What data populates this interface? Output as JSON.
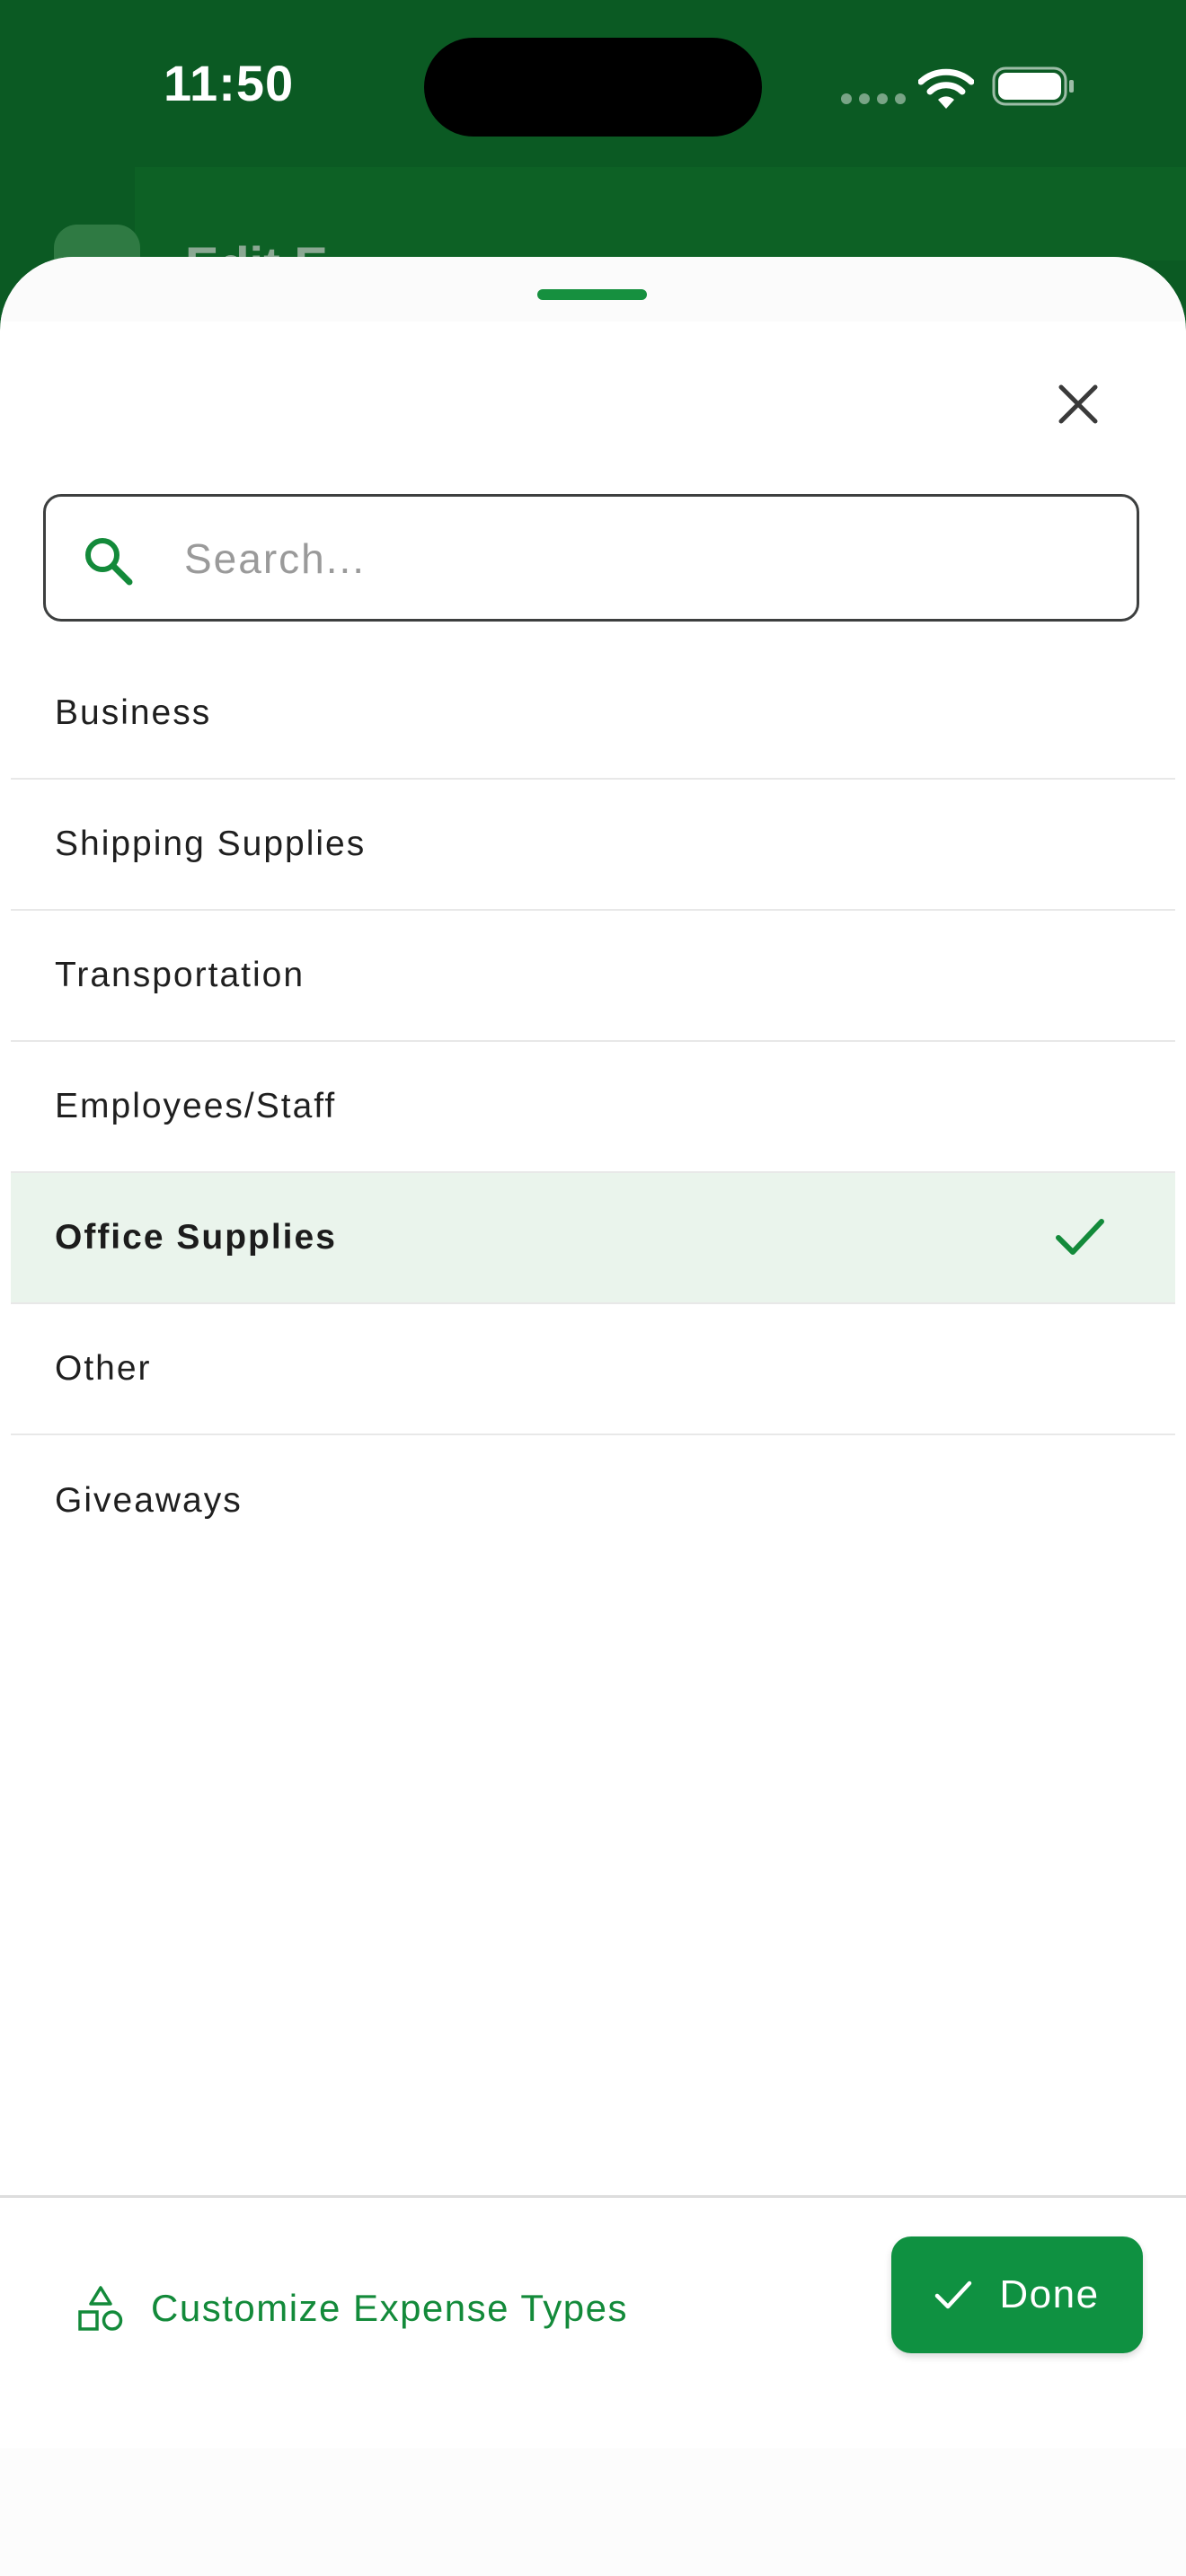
{
  "status_bar": {
    "time": "11:50",
    "icons": [
      "cellular-signal-icon",
      "wifi-icon",
      "battery-icon"
    ]
  },
  "background_screen": {
    "title": "Edit E"
  },
  "sheet": {
    "search": {
      "placeholder": "Search...",
      "value": ""
    },
    "expense_types": [
      {
        "label": "Business",
        "selected": false
      },
      {
        "label": "Shipping Supplies",
        "selected": false
      },
      {
        "label": "Transportation",
        "selected": false
      },
      {
        "label": "Employees/Staff",
        "selected": false
      },
      {
        "label": "Office Supplies",
        "selected": true
      },
      {
        "label": "Other",
        "selected": false
      },
      {
        "label": "Giveaways",
        "selected": false
      }
    ],
    "footer": {
      "customize_label": "Customize Expense Types",
      "done_label": "Done"
    }
  },
  "colors": {
    "accent": "#0f9141",
    "header_green": "#0b5a23",
    "selected_row_bg": "#eaf4ec"
  }
}
